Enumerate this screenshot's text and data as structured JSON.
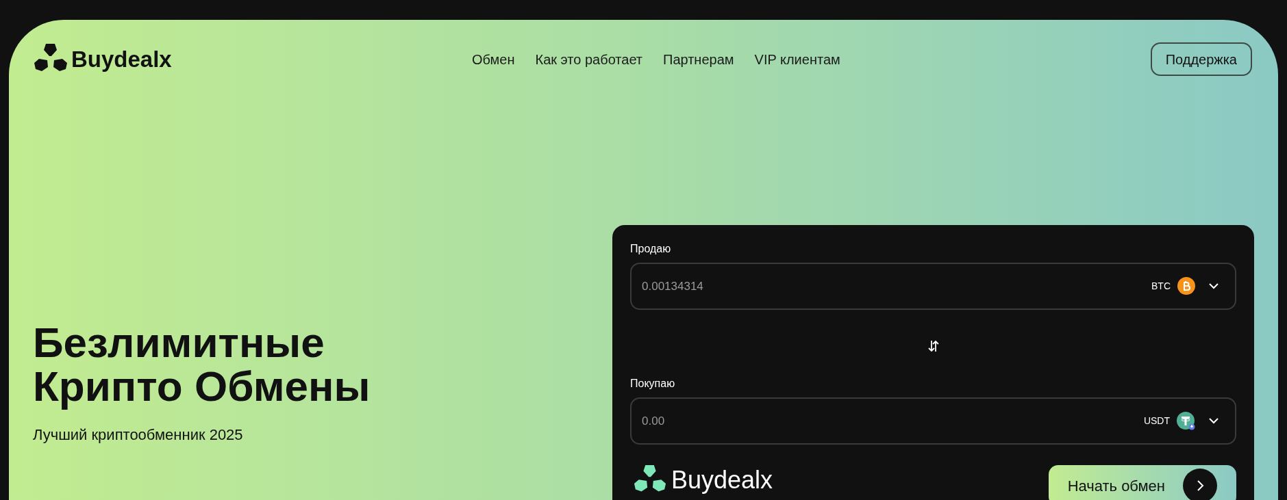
{
  "brand": {
    "name": "Buydealx"
  },
  "nav": [
    {
      "label": "Обмен"
    },
    {
      "label": "Как это работает"
    },
    {
      "label": "Партнерам"
    },
    {
      "label": "VIP клиентам"
    }
  ],
  "support_button": {
    "label": "Поддержка"
  },
  "hero": {
    "title_lines": [
      "Безлимитные",
      "Крипто Обмены"
    ],
    "subtitle": "Лучший криптообменник 2025"
  },
  "exchange": {
    "fields": [
      {
        "label": "Продаю",
        "value": "0.00134314",
        "currency": "BTC",
        "kind": "btc"
      },
      {
        "label": "Покупаю",
        "placeholder": "0.00",
        "currency": "USDT",
        "kind": "usdt"
      }
    ],
    "footer_brand": "Buydealx",
    "start_button": "Начать обмен"
  }
}
